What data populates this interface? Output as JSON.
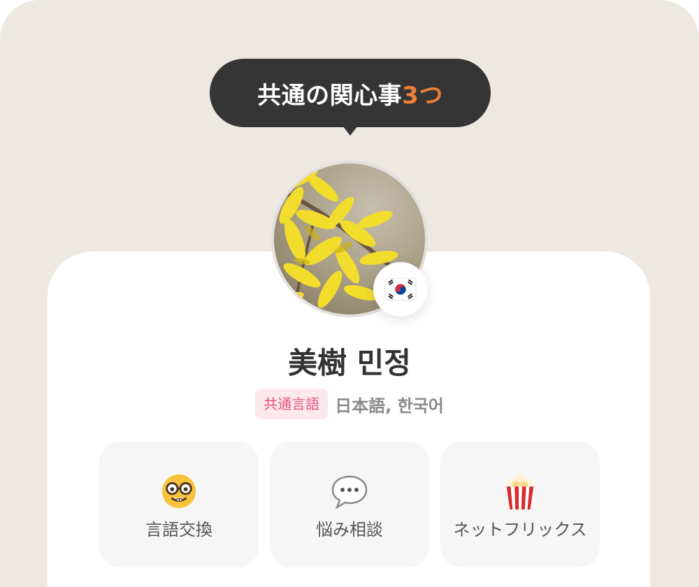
{
  "bubble": {
    "prefix": "共通の関心事",
    "count": "3つ"
  },
  "profile": {
    "name": "美樹 민정",
    "flag_icon": "korea-flag-icon",
    "avatar_icon": "forsythia-photo"
  },
  "languages": {
    "tag": "共通言語",
    "list": "日本語, 한국어"
  },
  "interests": [
    {
      "icon": "nerd-face-icon",
      "label": "言語交換"
    },
    {
      "icon": "speech-bubble-icon",
      "label": "悩み相談"
    },
    {
      "icon": "popcorn-icon",
      "label": "ネットフリックス"
    }
  ],
  "colors": {
    "background": "#ede8e2",
    "bubble": "#353535",
    "accent": "#f07f3a",
    "tag_bg": "#fde8ee",
    "tag_text": "#e8537a"
  }
}
